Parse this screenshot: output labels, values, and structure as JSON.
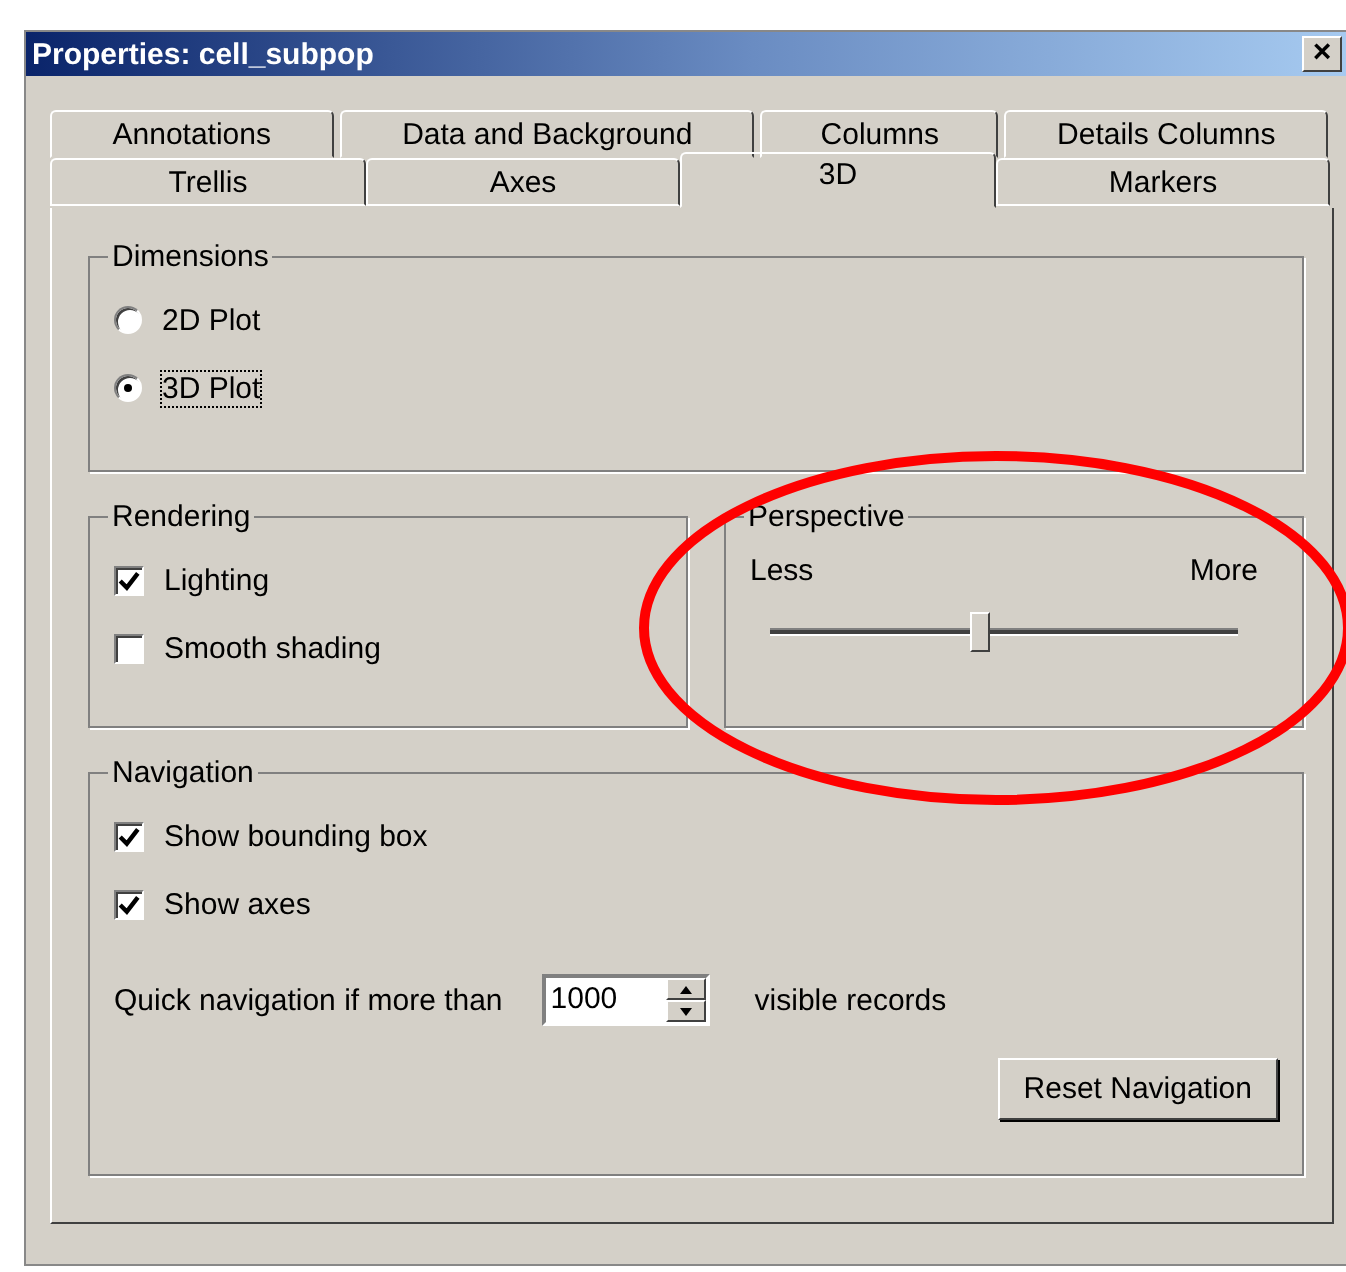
{
  "window": {
    "title": "Properties: cell_subpop",
    "close": "×"
  },
  "tab_rows": [
    [
      {
        "label": "Annotations",
        "selected": false
      },
      {
        "label": "Data and Background",
        "selected": false
      },
      {
        "label": "Columns",
        "selected": false
      },
      {
        "label": "Details Columns",
        "selected": false
      }
    ],
    [
      {
        "label": "Trellis",
        "selected": false
      },
      {
        "label": "Axes",
        "selected": false
      },
      {
        "label": "3D",
        "selected": true
      },
      {
        "label": "Markers",
        "selected": false
      }
    ]
  ],
  "dimensions": {
    "title": "Dimensions",
    "options": [
      {
        "label": "2D Plot",
        "selected": false
      },
      {
        "label": "3D Plot",
        "selected": true
      }
    ]
  },
  "rendering": {
    "title": "Rendering",
    "options": [
      {
        "label": "Lighting",
        "checked": true
      },
      {
        "label": "Smooth shading",
        "checked": false
      }
    ]
  },
  "perspective": {
    "title": "Perspective",
    "min_label": "Less",
    "max_label": "More",
    "level": 0.45
  },
  "navigation": {
    "title": "Navigation",
    "options": [
      {
        "label": "Show bounding box",
        "checked": true
      },
      {
        "label": "Show axes",
        "checked": true
      }
    ],
    "quick_label": "Quick navigation if more than",
    "quick_value": "1000",
    "quick_suffix": "visible records",
    "reset_button": "Reset Navigation"
  }
}
